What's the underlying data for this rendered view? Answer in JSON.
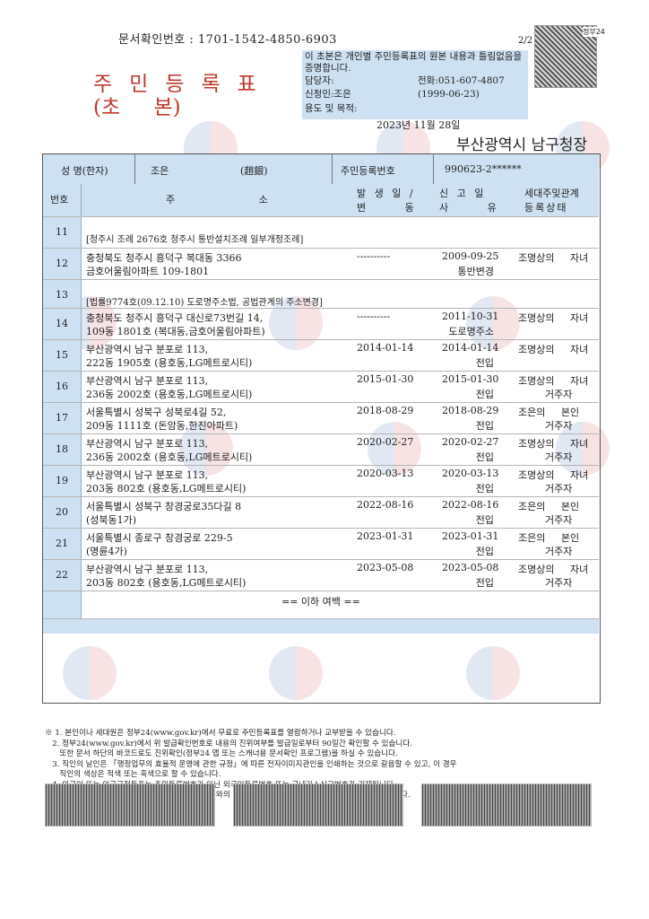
{
  "header": {
    "doc_confirm": "문서확인번호 : 1701-1542-4850-6903",
    "page": "2/2",
    "seal_label": "정부24",
    "title_main": "주민등록표",
    "title_sub": "(초 본)",
    "certify_text": "이 초본은 개인별 주민등록표의 원본 내용과 틀림없음을 증명합니다.",
    "staff_label": "담당자:",
    "phone": "전화:051-607-4807",
    "applicant": "신청인:조은",
    "birth": "(1999-06-23)",
    "purpose": "용도 및 목적:",
    "date": "2023년 11월 28일",
    "office": "부산광역시 남구청장"
  },
  "person": {
    "name_label": "성 명(한자)",
    "name": "조은",
    "hanja": "(趙銀)",
    "rrn_label": "주민등록번호",
    "rrn": "990623-2******"
  },
  "columns": {
    "no": "번호",
    "address": "주 소",
    "date1a": "발 생 일 /",
    "date1b": "변 동",
    "date2a": "신 고 일",
    "date2b": "사 유",
    "rel_a": "세대주및관계",
    "rel_b": "등록상태"
  },
  "rows": [
    {
      "no": "11",
      "note": "[청주시 조례 2676호 청주시 통반설치조례 일부개정조례]"
    },
    {
      "no": "12",
      "addr1": "충청북도 청주시 흥덕구 복대동 3366",
      "addr2": "금호어울림아파트 109-1801",
      "occur": "----------",
      "report": "2009-09-25",
      "reason": "통반변경",
      "rel": "조명상의 자녀",
      "status": ""
    },
    {
      "no": "13",
      "note": "[법률9774호(09.12.10) 도로명주소법, 공법관계의 주소변경]"
    },
    {
      "no": "14",
      "addr1": "충청북도 청주시 흥덕구 대신로73번길 14,",
      "addr2": "109동 1801호 (복대동,금호어울림아파트)",
      "occur": "----------",
      "report": "2011-10-31",
      "reason": "도로명주소",
      "rel": "조명상의 자녀",
      "status": ""
    },
    {
      "no": "15",
      "addr1": "부산광역시 남구 분포로 113,",
      "addr2": "222동 1905호 (용호동,LG메트로시티)",
      "occur": "2014-01-14",
      "report": "2014-01-14",
      "reason": "전입",
      "rel": "조명상의 자녀",
      "status": ""
    },
    {
      "no": "16",
      "addr1": "부산광역시 남구 분포로 113,",
      "addr2": "236동 2002호 (용호동,LG메트로시티)",
      "occur": "2015-01-30",
      "report": "2015-01-30",
      "reason": "전입",
      "rel": "조명상의 자녀",
      "status": "거주자"
    },
    {
      "no": "17",
      "addr1": "서울특별시 성북구 성북로4길 52,",
      "addr2": "209동 1111호 (돈암동,한진아파트)",
      "occur": "2018-08-29",
      "report": "2018-08-29",
      "reason": "전입",
      "rel": "조은의 본인",
      "status": "거주자"
    },
    {
      "no": "18",
      "addr1": "부산광역시 남구 분포로 113,",
      "addr2": "236동 2002호 (용호동,LG메트로시티)",
      "occur": "2020-02-27",
      "report": "2020-02-27",
      "reason": "전입",
      "rel": "조명상의 자녀",
      "status": "거주자"
    },
    {
      "no": "19",
      "addr1": "부산광역시 남구 분포로 113,",
      "addr2": "203동 802호 (용호동,LG메트로시티)",
      "occur": "2020-03-13",
      "report": "2020-03-13",
      "reason": "전입",
      "rel": "조명상의 자녀",
      "status": "거주자"
    },
    {
      "no": "20",
      "addr1": "서울특별시 성북구 창경궁로35다길 8",
      "addr2": "(성북동1가)",
      "occur": "2022-08-16",
      "report": "2022-08-16",
      "reason": "전입",
      "rel": "조은의 본인",
      "status": "거주자"
    },
    {
      "no": "21",
      "addr1": "서울특별시 종로구 창경궁로 229-5",
      "addr2": "(명륜4가)",
      "occur": "2023-01-31",
      "report": "2023-01-31",
      "reason": "전입",
      "rel": "조은의 본인",
      "status": "거주자"
    },
    {
      "no": "22",
      "addr1": "부산광역시 남구 분포로 113,",
      "addr2": "203동 802호 (용호동,LG메트로시티)",
      "occur": "2023-05-08",
      "report": "2023-05-08",
      "reason": "전입",
      "rel": "조명상의 자녀",
      "status": "거주자"
    }
  ],
  "end_text": "== 이하 여백 ==",
  "footnotes": [
    "※ 1. 본인이나 세대원은 정부24(www.gov.kr)에서 무료로 주민등록표를 열람하거나 교부받을 수 있습니다.",
    "   2. 정부24(www.gov.kr)에서 위 발급확인번호로 내용의 진위여부를 발급일로부터 90일간 확인할 수 있습니다.",
    "      또한 문서 하단의 바코드로도 진위확인(정부24 앱 또는 스캐너용 문서확인 프로그램)을 하실 수 있습니다.",
    "   3. 직인의 날인은 「행정업무의 효율적 운영에 관한 규정」에 따른 전자이미지관인을 인쇄하는 것으로 갈음할 수 있고, 이 경우",
    "      직인의 색상은 적색 또는 흑색으로 할 수 있습니다.",
    "   4. 외국인 또는 외국국적동포는 주민등록번호가 아닌 외국인등록번호 또는 국내거소신고번호가 기재됩니다.",
    "   5. 정확한 가족관계는 주민등록표 등·초본상 세대주와의 관계가 아닌 가족관계증명서 등으로 확인하여야 합니다."
  ]
}
